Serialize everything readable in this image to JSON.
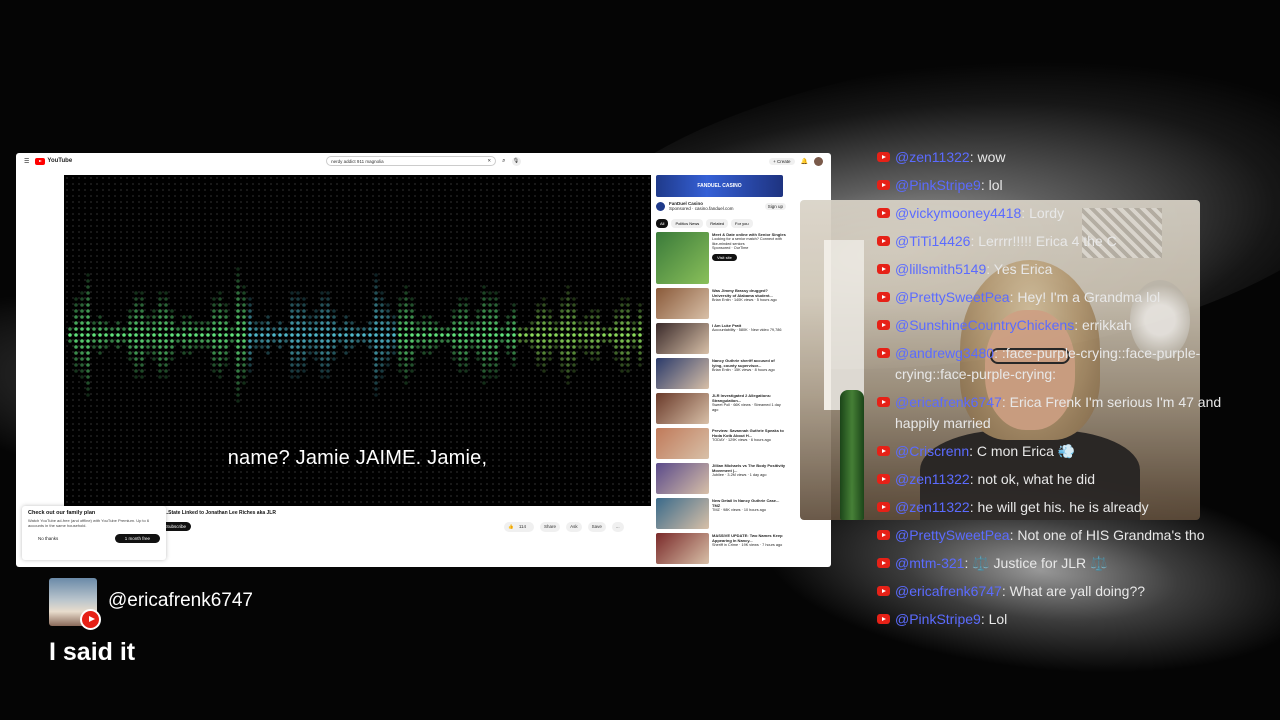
{
  "youtube": {
    "search_query": "nerdy addict 911 magnolia",
    "create_label": "Create",
    "caption": "name? Jamie JAIME. Jamie,",
    "video_title": "...State Linked to Jonathan Lee Riches aka JLR",
    "subscribe_label": "Subscribe",
    "actions": [
      "114",
      "Share",
      "Ask",
      "Save",
      "..."
    ],
    "family_plan": {
      "title": "Check out our family plan",
      "body": "Watch YouTube ad-free (and offline) with YouTube Premium. Up to 6 accounts in the same household.",
      "no_thanks": "No thanks",
      "trial": "1 month free"
    },
    "sidebar": {
      "ad_brand": "FANDUEL CASINO",
      "ad_title": "FanDuel Casino",
      "ad_sub": "Sponsored · casino.fanduel.com",
      "ad_signup": "Sign up",
      "chips": [
        "All",
        "Politics News",
        "Related",
        "For you"
      ],
      "first_rec": {
        "title": "Meet & Date online with Senior Singles",
        "sub": "Looking for a senior match? Connect with like-minded seniors",
        "sponsor": "Sponsored · OurTime",
        "visit": "Visit site"
      },
      "recs": [
        {
          "title": "Was Jimmy Brassy drugged? University of Alabama student...",
          "meta": "Brian Entin · 140K views · 5 hours ago"
        },
        {
          "title": "I Am Luke Pratt",
          "meta": "Accountability · 580K · New video 79,786"
        },
        {
          "title": "Nancy Guthrie sheriff accused of lying, county supervisor...",
          "meta": "Brian Entin · 15K views · 8 hours ago"
        },
        {
          "title": "JLR Investigated 2 Allegations: Strangulation...",
          "meta": "Sweet Poll · 66K views · Streamed 1 day ago"
        },
        {
          "title": "Preview: Savannah Guthrie Speaks to Hoda Kotb About H...",
          "meta": "TODAY · 129K views · 6 hours ago"
        },
        {
          "title": "Jillian Michaels vs The Body Positivity Movement |...",
          "meta": "Jubilee · 3.2M views · 1 day ago"
        },
        {
          "title": "New Detail In Nancy Guthrie Case... TMZ",
          "meta": "TMZ · 98K views · 10 hours ago"
        },
        {
          "title": "MASSIVE UPDATE: Two Names Keep Appearing In Nancy...",
          "meta": "Sheriff in Crime · 19K views · 7 hours ago"
        }
      ]
    }
  },
  "chat": [
    {
      "user": "@zen11322",
      "text": "wow"
    },
    {
      "user": "@PinkStripe9",
      "text": "lol"
    },
    {
      "user": "@vickymooney4418",
      "text": "Lordy"
    },
    {
      "user": "@TiTi14426",
      "text": "Lerrrr!!!!! Erica 4 the C"
    },
    {
      "user": "@lillsmith5149",
      "text": "Yes Erica"
    },
    {
      "user": "@PrettySweetPea",
      "text": "Hey! I'm a Grandma lol"
    },
    {
      "user": "@SunshineCountryChickens",
      "text": "errikkah"
    },
    {
      "user": "@andrewg3480",
      "text": ":face-purple-crying::face-purple-crying::face-purple-crying:"
    },
    {
      "user": "@ericafrenk6747",
      "text": "Erica Frenk I'm serious I'm 47 and happily married"
    },
    {
      "user": "@Criscrenn",
      "text": "C mon Erica 💨"
    },
    {
      "user": "@zen11322",
      "text": "not ok, what he did"
    },
    {
      "user": "@zen11322",
      "text": "he will get his. he is already"
    },
    {
      "user": "@PrettySweetPea",
      "text": "Not one of HIS Grandma's tho"
    },
    {
      "user": "@mtm-321",
      "text": "⚖️ Justice for JLR ⚖️"
    },
    {
      "user": "@ericafrenk6747",
      "text": "What are yall doing??"
    },
    {
      "user": "@PinkStripe9",
      "text": "Lol"
    }
  ],
  "featured": {
    "user": "@ericafrenk6747",
    "message": "I said it"
  },
  "colors": {
    "chat_username": "#5b6bff",
    "youtube_red": "#e62117"
  }
}
